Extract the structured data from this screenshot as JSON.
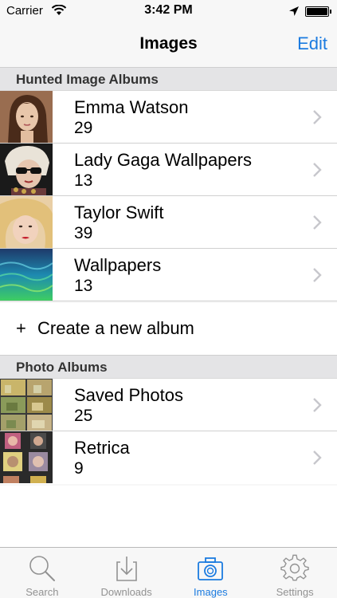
{
  "status_bar": {
    "carrier": "Carrier",
    "time": "3:42 PM"
  },
  "nav": {
    "title": "Images",
    "edit_label": "Edit"
  },
  "hunted_section": {
    "header": "Hunted Image Albums",
    "albums": [
      {
        "name": "Emma Watson",
        "count": "29"
      },
      {
        "name": "Lady Gaga Wallpapers",
        "count": "13"
      },
      {
        "name": "Taylor Swift",
        "count": "39"
      },
      {
        "name": "Wallpapers",
        "count": "13"
      }
    ],
    "create_label": "Create a new album",
    "create_icon": "+"
  },
  "photo_section": {
    "header": "Photo Albums",
    "albums": [
      {
        "name": "Saved Photos",
        "count": "25"
      },
      {
        "name": "Retrica",
        "count": "9"
      }
    ]
  },
  "tab_bar": {
    "tabs": [
      {
        "label": "Search",
        "icon": "search-icon"
      },
      {
        "label": "Downloads",
        "icon": "download-icon"
      },
      {
        "label": "Images",
        "icon": "camera-icon"
      },
      {
        "label": "Settings",
        "icon": "gear-icon"
      }
    ],
    "active_index": 2
  },
  "colors": {
    "accent": "#1b7be0",
    "inactive": "#929292"
  }
}
